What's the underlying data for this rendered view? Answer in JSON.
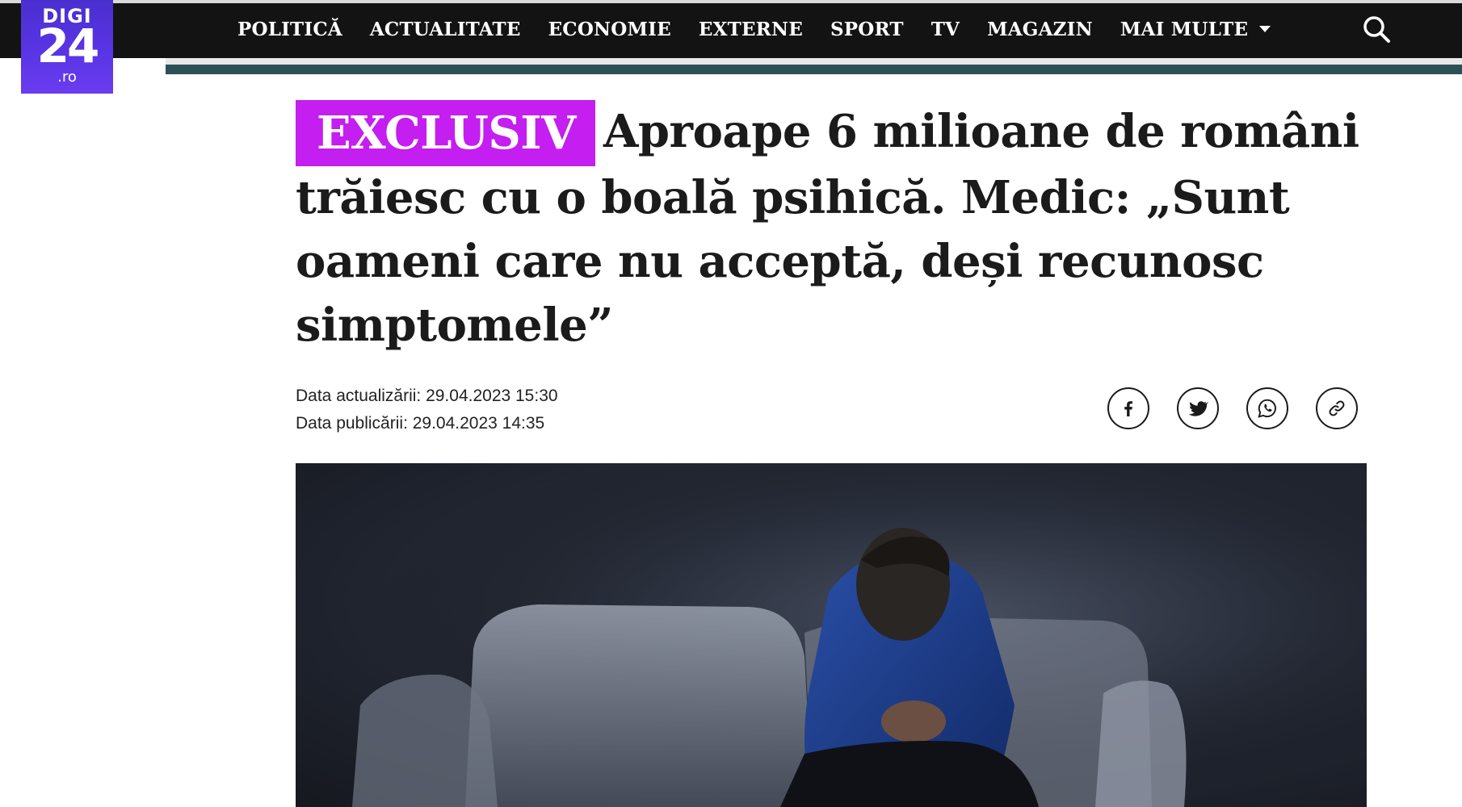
{
  "logo": {
    "line1": "DIGI",
    "line2": "24",
    "line3": ".ro"
  },
  "nav": {
    "items": [
      {
        "label": "POLITICĂ"
      },
      {
        "label": "ACTUALITATE"
      },
      {
        "label": "ECONOMIE"
      },
      {
        "label": "EXTERNE"
      },
      {
        "label": "SPORT"
      },
      {
        "label": "TV"
      },
      {
        "label": "MAGAZIN"
      },
      {
        "label": "MAI MULTE"
      }
    ],
    "search_icon": "search-icon",
    "more_icon": "caret-down-icon"
  },
  "article": {
    "badge": "EXCLUSIV",
    "title": "Aproape 6 milioane de români trăiesc cu o boală psihică. Medic: „Sunt oameni care nu acceptă, deși recunosc simptomele”",
    "updated": "Data actualizării: 29.04.2023 15:30",
    "published": "Data publicării: 29.04.2023 14:35"
  },
  "share": {
    "icons": [
      "facebook-icon",
      "twitter-icon",
      "whatsapp-icon",
      "link-icon"
    ]
  },
  "colors": {
    "topbar": "#131313",
    "badge": "#c41ef0",
    "accent_bar": "#2d4f56",
    "logo": "#5b35e6"
  }
}
